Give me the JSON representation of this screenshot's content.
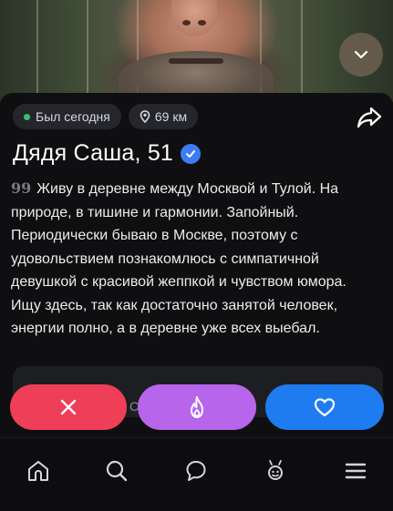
{
  "profile": {
    "status": "Был сегодня",
    "distance": "69 км",
    "name": "Дядя Саша, 51",
    "quote_mark": "99",
    "bio": "Живу в деревне между Москвой и Тулой. На природе, в тишине и гармонии. Запойный. Периодически бываю в Москве, поэтому с удовольствием познакомлюсь с симпатичной девушкой с красивой жеппкой и чувством юмора. Ищу здесь, так как достаточно занятой человек, энергии полно, а в деревне уже всех выебал."
  },
  "next_card": {
    "peek_text": "С"
  },
  "actions": {
    "dislike_icon": "close-icon",
    "super_icon": "flame-icon",
    "like_icon": "heart-icon"
  },
  "nav": {
    "items": [
      "home-icon",
      "search-icon",
      "chat-icon",
      "matches-icon",
      "menu-icon"
    ]
  },
  "colors": {
    "online": "#33c26b",
    "verified": "#3d7cf2",
    "dislike": "#ef3e57",
    "super": "#b765ea",
    "like": "#1f7cf0"
  }
}
